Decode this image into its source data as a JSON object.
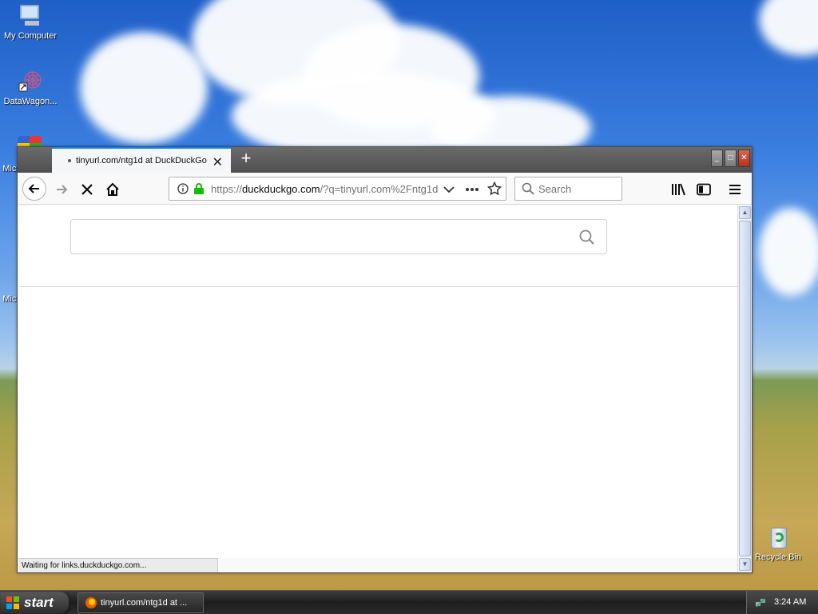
{
  "desktop": {
    "icons": [
      {
        "label": "My Computer"
      },
      {
        "label": "DataWagon..."
      },
      {
        "label": "Micr"
      },
      {
        "label": "Micr"
      },
      {
        "label": "Recycle Bin"
      }
    ]
  },
  "browser": {
    "tab": {
      "title": "tinyurl.com/ntg1d at DuckDuckGo",
      "close": "✕"
    },
    "new_tab": "+",
    "window_buttons": {
      "minimize": "_",
      "maximize": "□",
      "close": "✕"
    },
    "url": {
      "prefix": "https://",
      "domain": "duckduckgo.com",
      "path": "/?q=tinyurl.com%2Fntg1d"
    },
    "search_placeholder": "Search",
    "status": "Waiting for links.duckduckgo.com..."
  },
  "taskbar": {
    "start_label": "start",
    "task_item": "tinyurl.com/ntg1d at ...",
    "clock": "3:24 AM"
  },
  "colors": {
    "accent": "#0a84ff",
    "lock_green": "#12bc00"
  }
}
